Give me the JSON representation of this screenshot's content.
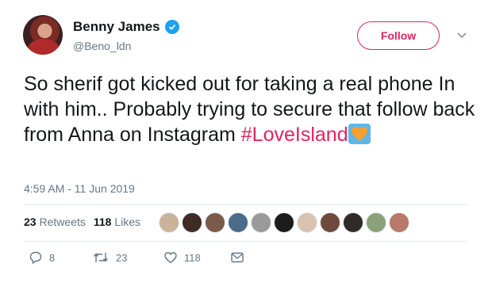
{
  "user": {
    "name": "Benny James",
    "handle": "@Beno_ldn"
  },
  "follow_label": "Follow",
  "tweet": {
    "text": "So sherif got kicked out for taking a real phone In with him.. Probably trying to secure that follow back from Anna on Instagram ",
    "hashtag": "#LoveIsland"
  },
  "timestamp": "4:59 AM - 11 Jun 2019",
  "stats": {
    "retweets_count": "23",
    "retweets_label": "Retweets",
    "likes_count": "118",
    "likes_label": "Likes"
  },
  "liker_colors": [
    "#c9b39a",
    "#3d2b24",
    "#7a5a48",
    "#4a6b8a",
    "#9a9a9a",
    "#1c1c1c",
    "#d9c2b0",
    "#6e4a3a",
    "#2f2b2b",
    "#8aa17a",
    "#b8786a"
  ],
  "actions": {
    "reply_count": "8",
    "retweet_count": "23",
    "like_count": "118"
  },
  "colors": {
    "accent": "#e0245e",
    "verified": "#1da1f2",
    "secondary_text": "#657786"
  }
}
